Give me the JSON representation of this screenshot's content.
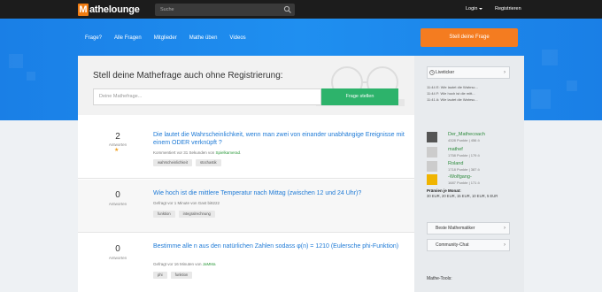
{
  "topbar": {
    "logo_text": "athelounge",
    "logo_letter": "M",
    "search_placeholder": "Suche",
    "login_label": "Login",
    "register_label": "Registrieren"
  },
  "nav": {
    "items": [
      "Frage?",
      "Alle Fragen",
      "Mitglieder",
      "Mathe üben",
      "Videos"
    ],
    "ask_button": "Stell deine Frage"
  },
  "ask": {
    "title": "Stell deine Mathefrage auch ohne Registrierung:",
    "placeholder": "Deine Mathefrage...",
    "submit": "Frage stellen"
  },
  "questions": [
    {
      "count": "2",
      "count_label": "Antworten",
      "title": "Die lautet die Wahrscheinlichkeit, wenn man zwei von einander unabhängige Ereignisse mit einem ODER verknüpft ?",
      "meta_prefix": "Kommentiert vor 31 Sekunden von ",
      "meta_user": "Spielkamerad",
      "meta_suffix": ".",
      "tags": [
        "wahrscheinlichkeit",
        "stochastik"
      ],
      "starred": true
    },
    {
      "count": "0",
      "count_label": "Antworten",
      "title": "Wie hoch ist die mittlere Temperatur nach Mittag (zwischen 12 und 24 Uhr)?",
      "meta_prefix": "Gefragt vor 1 Minute von Gast bi8222",
      "meta_user": "",
      "meta_suffix": "",
      "tags": [
        "funktion",
        "integralrechnung"
      ],
      "starred": false
    },
    {
      "count": "0",
      "count_label": "Antworten",
      "title": "Bestimme alle n aus den natürlichen Zahlen sodass φ(n) = 1210 (Eulersche phi-Funktion)",
      "meta_prefix": "Gefragt vor 16 Minuten von ",
      "meta_user": "JaMMa",
      "meta_suffix": "",
      "tags": [
        "phi",
        "funktion"
      ],
      "starred": false
    }
  ],
  "sidebar": {
    "liveticker_label": "Liveticker",
    "ticker": [
      "11:44 E: Wie lautet die Wahrsc...",
      "11:44 F: Wie hoch ist die mitt...",
      "11:41 A: Wie lautet die Wahrsc..."
    ],
    "top_users": [
      {
        "name": "Der_Mathecoach",
        "points": "4328 Punkte | 456 ö"
      },
      {
        "name": "mathef",
        "points": "1758 Punkte | 179 ö"
      },
      {
        "name": "Roland",
        "points": "1718 Punkte | 387 ö"
      },
      {
        "name": "-Wolfgang-",
        "points": "1687 Punkte | 171 ö"
      }
    ],
    "prize_title": "Prämien je Monat:",
    "prize_line": "30 EUR, 20 EUR, 15 EUR, 10 EUR, 5 EUR",
    "best_label": "Beste Mathematiker",
    "chat_label": "Community-Chat",
    "tools_label": "Mathe-Tools:"
  },
  "colors": {
    "brand_orange": "#f47c20",
    "hero_blue": "#1f8ff0",
    "submit_green": "#2db36b",
    "link_blue": "#1e7ad6"
  }
}
